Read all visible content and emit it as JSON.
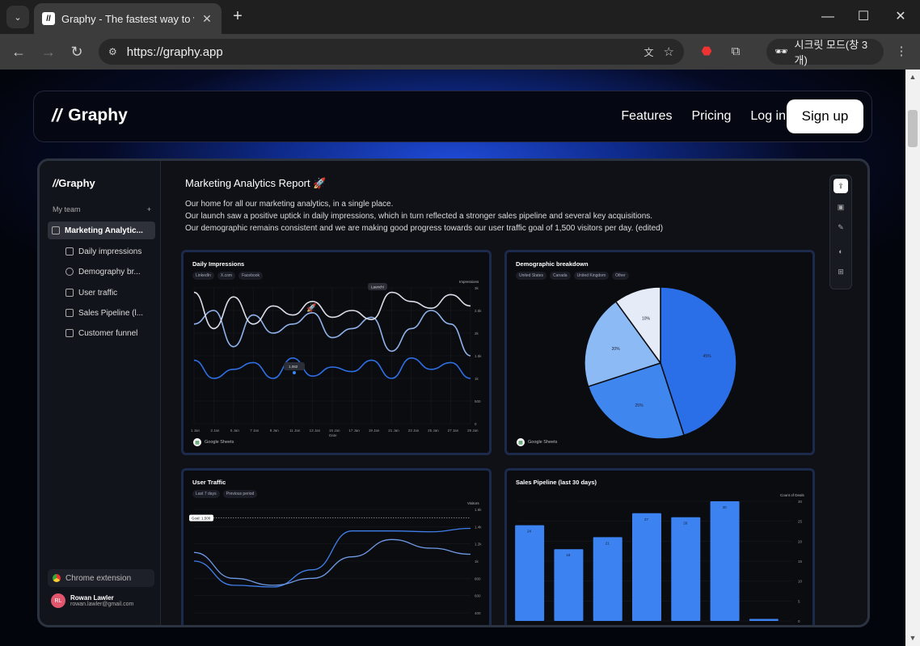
{
  "browser": {
    "tab_title": "Graphy - The fastest way to vi",
    "url": "https://graphy.app",
    "incognito_label": "시크릿 모드(창 3개)"
  },
  "navbar": {
    "brand": "Graphy",
    "links": [
      "Features",
      "Pricing",
      "Log in"
    ],
    "signup": "Sign up"
  },
  "sidebar": {
    "brand": "Graphy",
    "team_label": "My team",
    "items": [
      {
        "label": "Marketing Analytic...",
        "icon": "board-icon"
      },
      {
        "label": "Daily impressions",
        "icon": "line-chart-icon"
      },
      {
        "label": "Demography br...",
        "icon": "pie-chart-icon"
      },
      {
        "label": "User traffic",
        "icon": "line-chart-icon"
      },
      {
        "label": "Sales Pipeline (l...",
        "icon": "bar-chart-icon"
      },
      {
        "label": "Customer funnel",
        "icon": "funnel-icon"
      }
    ],
    "extension": "Chrome extension",
    "user": {
      "initials": "RL",
      "name": "Rowan Lawler",
      "email": "rowan.lawler@gmail.com"
    }
  },
  "report": {
    "title": "Marketing Analytics Report 🚀",
    "description": [
      "Our home for all our marketing analytics, in a single place.",
      "Our launch saw a positive uptick in daily impressions, which in turn reflected a stronger sales pipeline and several key acquisitions.",
      "Our demographic remains consistent and we are making good progress towards our user traffic goal of 1,500 visitors per day. (edited)"
    ]
  },
  "chart_data": [
    {
      "type": "line",
      "title": "Daily Impressions",
      "source": "Google Sheets",
      "ylabel": "Impressions",
      "xlabel": "Date",
      "ylim": [
        0,
        3000
      ],
      "yticks": [
        "3k",
        "2.5k",
        "2k",
        "1.5k",
        "1k",
        "500",
        "0"
      ],
      "x": [
        "1 Jan",
        "3 Jan",
        "5 Jan",
        "7 Jan",
        "9 Jan",
        "11 Jan",
        "13 Jan",
        "15 Jan",
        "17 Jan",
        "19 Jan",
        "21 Jan",
        "23 Jan",
        "25 Jan",
        "27 Jan",
        "29 Jan"
      ],
      "annotations": [
        "Launch!",
        "1,082"
      ],
      "series": [
        {
          "name": "LinkedIn",
          "color": "#2f6fe6",
          "values": [
            1400,
            1000,
            1200,
            1350,
            1000,
            1450,
            1050,
            1250,
            1150,
            1400,
            1000,
            1450,
            1200,
            1350,
            1000
          ]
        },
        {
          "name": "X.com",
          "color": "#8fb2ea",
          "values": [
            2200,
            2500,
            1700,
            2400,
            2000,
            2200,
            2450,
            1900,
            2100,
            2350,
            1600,
            2100,
            2500,
            2200,
            1500
          ]
        },
        {
          "name": "Facebook",
          "color": "#d8dde8",
          "values": [
            2900,
            2100,
            2800,
            2200,
            2600,
            2400,
            2700,
            2350,
            2500,
            2300,
            2900,
            2700,
            2550,
            2850,
            2600
          ]
        }
      ]
    },
    {
      "type": "pie",
      "title": "Demographic breakdown",
      "source": "Google Sheets",
      "categories": [
        "United States",
        "Canada",
        "United Kingdom",
        "Other"
      ],
      "values": [
        45,
        25,
        20,
        10
      ],
      "labels": [
        "45%",
        "25%",
        "20%",
        "10%"
      ],
      "colors": [
        "#2a6fe8",
        "#3f86ee",
        "#8cbaf5",
        "#e5ecf8"
      ]
    },
    {
      "type": "line",
      "title": "User Traffic",
      "ylabel": "Visitors",
      "goal_label": "Goal: 1,500",
      "yticks": [
        "1.6k",
        "1.4k",
        "1.2k",
        "1k",
        "800",
        "600",
        "400"
      ],
      "ylim": [
        400,
        1600
      ],
      "series": [
        {
          "name": "Last 7 days",
          "color": "#3f7fe8",
          "values": [
            1000,
            720,
            700,
            900,
            1350,
            1350,
            1340,
            1380
          ]
        },
        {
          "name": "Previous period",
          "color": "#6f9ae6",
          "values": [
            1100,
            800,
            720,
            800,
            1050,
            1250,
            1150,
            1080
          ]
        }
      ]
    },
    {
      "type": "bar",
      "title": "Sales Pipeline (last 30 days)",
      "ylabel": "Count of Deals",
      "yticks": [
        "30",
        "25",
        "20",
        "15",
        "10",
        "5",
        "0"
      ],
      "ylim": [
        0,
        30
      ],
      "categories": [
        "",
        "",
        "",
        "",
        "",
        "",
        ""
      ],
      "values": [
        24,
        18,
        21,
        27,
        26,
        30,
        0.5
      ],
      "labels": [
        "24",
        "18",
        "21",
        "27",
        "26",
        "30",
        ""
      ],
      "color": "#3c82f0"
    }
  ]
}
